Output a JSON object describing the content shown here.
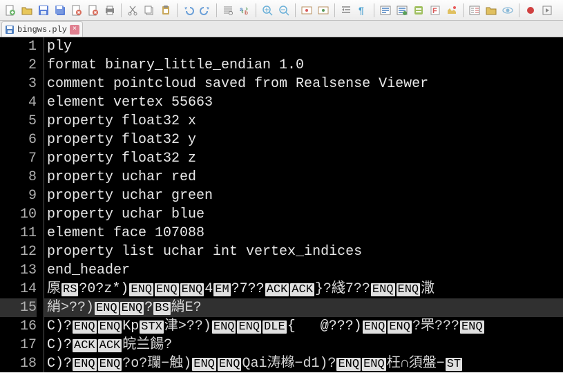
{
  "toolbar": {
    "groups": [
      [
        "new-file",
        "open-file",
        "save",
        "save-all",
        "close",
        "close-all",
        "print"
      ],
      [
        "cut",
        "copy",
        "paste"
      ],
      [
        "undo",
        "redo"
      ],
      [
        "find",
        "find-replace"
      ],
      [
        "zoom-in",
        "zoom-out"
      ],
      [
        "word-wrap",
        "show-all-chars"
      ],
      [
        "indent-guide",
        "show-symbol"
      ],
      [
        "highlight-lang",
        "user-define",
        "fold-all",
        "toggle-fold",
        "doc-map"
      ],
      [
        "show-func-list",
        "open-folder",
        "eye-monitor"
      ],
      [
        "record-macro",
        "play-macro"
      ]
    ]
  },
  "tab": {
    "icon": "save-disk-icon",
    "label": "bingws.ply",
    "close": "×"
  },
  "editor": {
    "lines": [
      {
        "n": 1,
        "text": "ply"
      },
      {
        "n": 2,
        "text": "format binary_little_endian 1.0"
      },
      {
        "n": 3,
        "text": "comment pointcloud saved from Realsense Viewer"
      },
      {
        "n": 4,
        "text": "element vertex 55663"
      },
      {
        "n": 5,
        "text": "property float32 x"
      },
      {
        "n": 6,
        "text": "property float32 y"
      },
      {
        "n": 7,
        "text": "property float32 z"
      },
      {
        "n": 8,
        "text": "property uchar red"
      },
      {
        "n": 9,
        "text": "property uchar green"
      },
      {
        "n": 10,
        "text": "property uchar blue"
      },
      {
        "n": 11,
        "text": "element face 107088"
      },
      {
        "n": 12,
        "text": "property list uchar int vertex_indices"
      },
      {
        "n": 13,
        "text": "end_header"
      },
      {
        "n": 14,
        "segments": [
          {
            "t": "厡",
            "c": "cjk"
          },
          {
            "t": "RS",
            "c": "ctl"
          },
          {
            "t": "?0?z*)"
          },
          {
            "t": "ENQ",
            "c": "ctl"
          },
          {
            "t": "ENQ",
            "c": "ctl"
          },
          {
            "t": "ENQ",
            "c": "ctl"
          },
          {
            "t": "4"
          },
          {
            "t": "EM",
            "c": "ctl"
          },
          {
            "t": "?7??"
          },
          {
            "t": "ACK",
            "c": "ctl"
          },
          {
            "t": "ACK",
            "c": "ctl"
          },
          {
            "t": "}?綫7??",
            "c": "cjk"
          },
          {
            "t": "ENQ",
            "c": "ctl"
          },
          {
            "t": "ENQ",
            "c": "ctl"
          },
          {
            "t": "潵",
            "c": "cjk"
          }
        ]
      },
      {
        "n": 15,
        "hl": true,
        "segments": [
          {
            "t": "綃>??)",
            "c": "cjk"
          },
          {
            "t": "ENQ",
            "c": "ctl"
          },
          {
            "t": "ENQ",
            "c": "ctl"
          },
          {
            "t": "?"
          },
          {
            "t": "BS",
            "c": "ctl"
          },
          {
            "t": "綃E?",
            "c": "cjk"
          }
        ]
      },
      {
        "n": 16,
        "segments": [
          {
            "t": "C)?"
          },
          {
            "t": "ENQ",
            "c": "ctl"
          },
          {
            "t": "ENQ",
            "c": "ctl"
          },
          {
            "t": "Kp"
          },
          {
            "t": "STX",
            "c": "ctl"
          },
          {
            "t": "津>??)",
            "c": "cjk"
          },
          {
            "t": "ENQ",
            "c": "ctl"
          },
          {
            "t": "ENQ",
            "c": "ctl"
          },
          {
            "t": "DLE",
            "c": "ctl"
          },
          {
            "t": "{   @???)"
          },
          {
            "t": "ENQ",
            "c": "ctl"
          },
          {
            "t": "ENQ",
            "c": "ctl"
          },
          {
            "t": "?罘???",
            "c": "cjk"
          },
          {
            "t": "ENQ",
            "c": "ctl"
          }
        ]
      },
      {
        "n": 17,
        "segments": [
          {
            "t": "C)?"
          },
          {
            "t": "ACK",
            "c": "ctl"
          },
          {
            "t": "ACK",
            "c": "ctl"
          },
          {
            "t": "皖兰餳?",
            "c": "cjk"
          }
        ]
      },
      {
        "n": 18,
        "segments": [
          {
            "t": "C)?"
          },
          {
            "t": "ENQ",
            "c": "ctl"
          },
          {
            "t": "ENQ",
            "c": "ctl"
          },
          {
            "t": "?o?瓓−触)",
            "c": "cjk"
          },
          {
            "t": "ENQ",
            "c": "ctl"
          },
          {
            "t": "ENQ",
            "c": "ctl"
          },
          {
            "t": "Qai涛橼−d1)?",
            "c": "cjk"
          },
          {
            "t": "ENQ",
            "c": "ctl"
          },
          {
            "t": "ENQ",
            "c": "ctl"
          },
          {
            "t": "枉∩須盤−",
            "c": "cjk"
          },
          {
            "t": "ST",
            "c": "ctl"
          }
        ]
      }
    ]
  },
  "icon_colors": {
    "new-file": "#6fb76f",
    "open-file": "#e8c75a",
    "save": "#5a7fd8",
    "save-all": "#5a7fd8",
    "close": "#d86b5a",
    "close-all": "#d86b5a",
    "print": "#888",
    "cut": "#888",
    "copy": "#888",
    "paste": "#c9a85a",
    "undo": "#6a9fd8",
    "redo": "#6a9fd8",
    "find": "#888",
    "find-replace": "#888",
    "zoom-in": "#6ab0d8",
    "zoom-out": "#6ab0d8",
    "word-wrap": "#b89060",
    "show-all-chars": "#b89060",
    "indent-guide": "#888",
    "show-symbol": "#4aa0d0",
    "highlight-lang": "#4a80c0",
    "user-define": "#4a80c0",
    "fold-all": "#a0c060",
    "toggle-fold": "#d85a5a",
    "doc-map": "#e0c060",
    "show-func-list": "#888",
    "open-folder": "#e0c060",
    "eye-monitor": "#89b9d8",
    "record-macro": "#d04040",
    "play-macro": "#888"
  }
}
